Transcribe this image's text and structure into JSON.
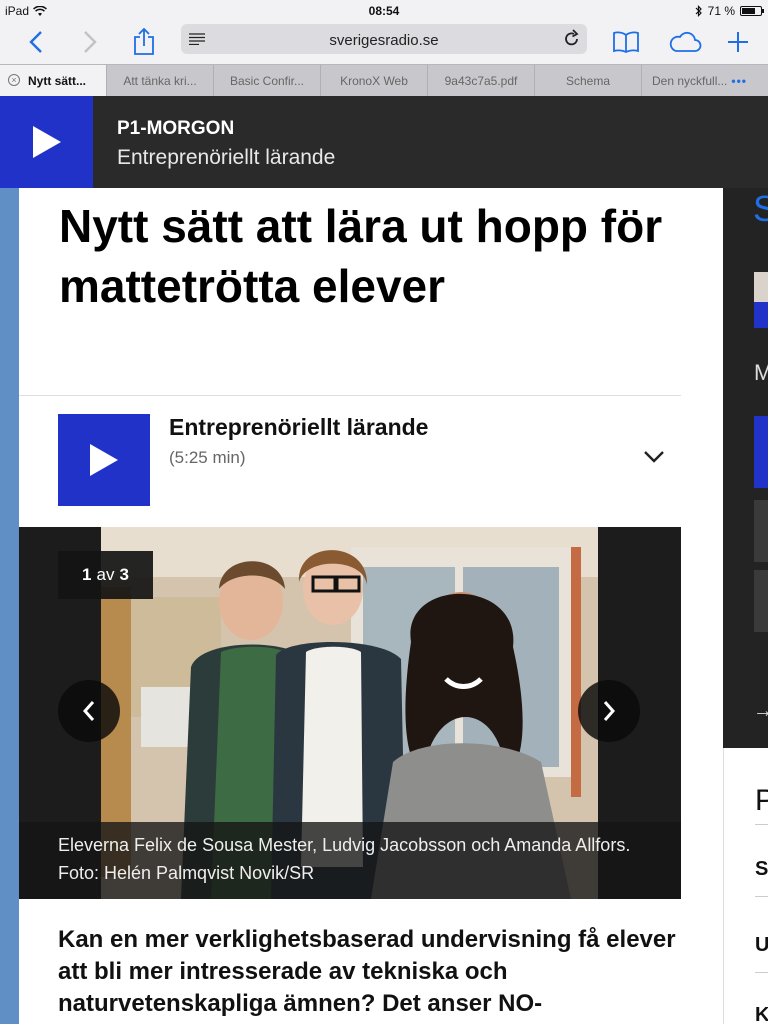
{
  "status": {
    "device": "iPad",
    "time": "08:54",
    "battery": "71 %",
    "battery_level": 0.71
  },
  "browser": {
    "url": "sverigesradio.se",
    "tabs": [
      {
        "label": "Nytt sätt...",
        "active": true
      },
      {
        "label": "Att tänka kri...",
        "active": false
      },
      {
        "label": "Basic Confir...",
        "active": false
      },
      {
        "label": "KronoX Web",
        "active": false
      },
      {
        "label": "9a43c7a5.pdf",
        "active": false
      },
      {
        "label": "Schema",
        "active": false
      },
      {
        "label": "Den nyckfull...",
        "active": false
      }
    ],
    "more_tabs": "•••"
  },
  "banner": {
    "program": "P1-MORGON",
    "episode": "Entreprenöriellt lärande"
  },
  "article": {
    "headline": "Nytt sätt att lära ut hopp för mattetrötta elever",
    "player": {
      "title": "Entreprenöriellt lärande",
      "duration": "(5:25 min)"
    },
    "gallery": {
      "current": "1",
      "of": "av",
      "total": "3",
      "caption": "Eleverna Felix de Sousa Mester, Ludvig Jacobsson och Amanda Allfors. Foto: Helén Palmqvist Novik/SR"
    },
    "lead": "Kan en mer verklighetsbaserad undervisning få elever att bli mer intresserade av tekniska och naturvetenskapliga ämnen? Det anser NO-"
  },
  "sidebar": {
    "dark_initial": "S",
    "dark_letter": "M",
    "arrow": "→",
    "white_letters": [
      "P",
      "S",
      "U",
      "K"
    ]
  },
  "colors": {
    "brand_blue": "#2132c9",
    "ios_blue": "#1e6fe6",
    "banner_bg": "#2a2a2a"
  }
}
